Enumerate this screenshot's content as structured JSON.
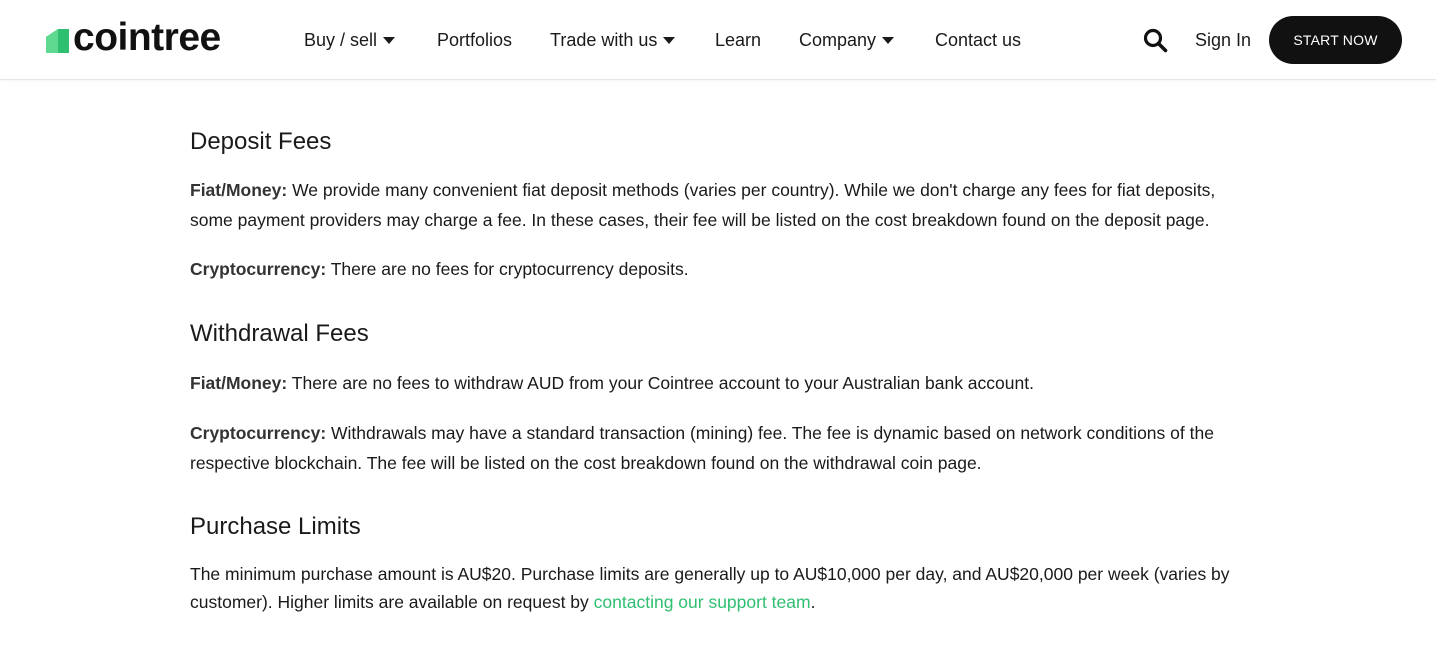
{
  "header": {
    "logo_text": "cointree",
    "nav": [
      {
        "label": "Buy / sell",
        "has_dropdown": true
      },
      {
        "label": "Portfolios",
        "has_dropdown": false
      },
      {
        "label": "Trade with us",
        "has_dropdown": true
      },
      {
        "label": "Learn",
        "has_dropdown": false
      },
      {
        "label": "Company",
        "has_dropdown": true
      },
      {
        "label": "Contact us",
        "has_dropdown": false
      }
    ],
    "sign_in": "Sign In",
    "cta": "START NOW",
    "icons": [
      "search-icon",
      "chevron-down-icon"
    ]
  },
  "colors": {
    "brand_green": "#2fbf71",
    "dark": "#111111"
  },
  "sections": {
    "deposit": {
      "title": "Deposit Fees",
      "fiat_label": "Fiat/Money:",
      "fiat_text": " We provide many convenient fiat deposit methods (varies per country). While we don't charge any fees for fiat deposits, some payment providers may charge a fee. In these cases, their fee will be listed on the cost breakdown found on the deposit page.",
      "crypto_label": "Cryptocurrency:",
      "crypto_text": " There are no fees for cryptocurrency deposits."
    },
    "withdrawal": {
      "title": "Withdrawal Fees",
      "fiat_label": "Fiat/Money:",
      "fiat_text": " There are no fees to withdraw AUD from your Cointree account to your Australian bank account.",
      "crypto_label": "Cryptocurrency:",
      "crypto_text": " Withdrawals may have a standard transaction (mining) fee. The fee is dynamic based on network conditions of the respective blockchain. The fee will be listed on the cost breakdown found on the withdrawal coin page."
    },
    "limits": {
      "title": "Purchase Limits",
      "text": "The minimum purchase amount is AU$20. Purchase limits are generally up to AU$10,000 per day, and AU$20,000 per week (varies by customer). Higher limits are available on request by ",
      "link_text": "contacting our support team",
      "text_end": "."
    }
  }
}
